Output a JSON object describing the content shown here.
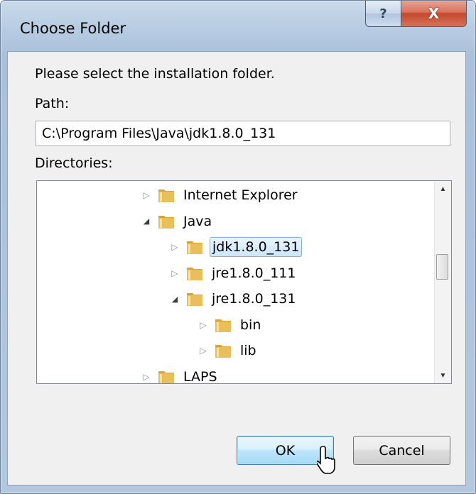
{
  "window": {
    "title": "Choose Folder",
    "help_glyph": "?",
    "close_glyph": "X"
  },
  "dialog": {
    "prompt": "Please select the installation folder.",
    "path_label": "Path:",
    "path_value": "C:\\Program Files\\Java\\jdk1.8.0_131",
    "directories_label": "Directories:"
  },
  "tree": {
    "items": [
      {
        "label": "Internet Explorer",
        "depth": 0,
        "state": "collapsed",
        "selected": false
      },
      {
        "label": "Java",
        "depth": 0,
        "state": "expanded",
        "selected": false
      },
      {
        "label": "jdk1.8.0_131",
        "depth": 1,
        "state": "collapsed",
        "selected": true
      },
      {
        "label": "jre1.8.0_111",
        "depth": 1,
        "state": "collapsed",
        "selected": false
      },
      {
        "label": "jre1.8.0_131",
        "depth": 1,
        "state": "expanded",
        "selected": false
      },
      {
        "label": "bin",
        "depth": 2,
        "state": "collapsed",
        "selected": false
      },
      {
        "label": "lib",
        "depth": 2,
        "state": "collapsed",
        "selected": false
      },
      {
        "label": "LAPS",
        "depth": 0,
        "state": "collapsed",
        "selected": false
      }
    ]
  },
  "buttons": {
    "ok": "OK",
    "cancel": "Cancel"
  },
  "colors": {
    "selection_fill": "#cde6fc",
    "selection_border": "#84acdd",
    "folder": "#e8bf5a"
  }
}
